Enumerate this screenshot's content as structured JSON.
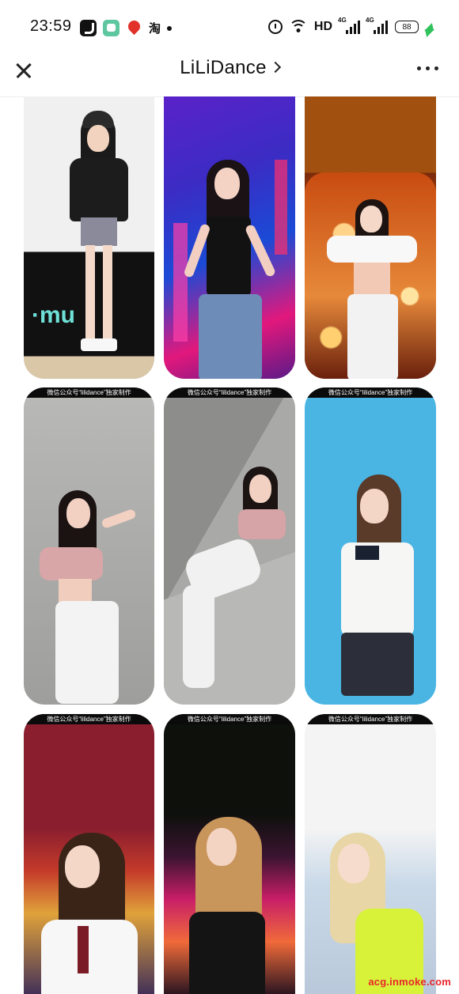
{
  "status_bar": {
    "time": "23:59",
    "app_icons": [
      "tiktok-icon",
      "chat-app-icon",
      "red-location-icon",
      "taobao-icon"
    ],
    "taobao_glyph": "淘",
    "hd_label": "HD",
    "signal_1_label": "4G",
    "signal_2_label": "4G",
    "battery": "88"
  },
  "nav": {
    "title": "LiLiDance",
    "close_icon": "close-icon",
    "more_icon": "more-icon"
  },
  "banner_text": "微信公众号“lilidance”独家制作",
  "watermark": "acg.inmoke.com",
  "colors": {
    "accent": "#111111",
    "charge": "#2fc25b",
    "watermark": "#e8262a"
  }
}
